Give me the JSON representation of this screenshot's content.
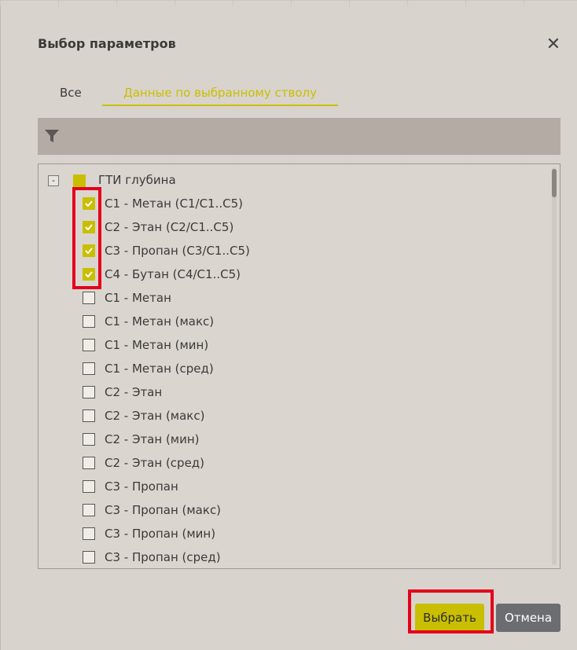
{
  "dialog": {
    "title": "Выбор параметров",
    "close_icon": "close-icon"
  },
  "tabs": [
    {
      "label": "Все",
      "active": false
    },
    {
      "label": "Данные по выбранному стволу",
      "active": true
    }
  ],
  "filter": {
    "icon": "filter-icon"
  },
  "tree": {
    "root": {
      "label": "ГТИ глубина",
      "expander": "-"
    },
    "items": [
      {
        "label": "C1 - Метан (C1/C1..C5)",
        "checked": true
      },
      {
        "label": "C2 - Этан (C2/C1..C5)",
        "checked": true
      },
      {
        "label": "C3 - Пропан (C3/C1..C5)",
        "checked": true
      },
      {
        "label": "C4 - Бутан (C4/C1..C5)",
        "checked": true
      },
      {
        "label": "C1 - Метан",
        "checked": false
      },
      {
        "label": "C1 - Метан (макс)",
        "checked": false
      },
      {
        "label": "C1 - Метан (мин)",
        "checked": false
      },
      {
        "label": "C1 - Метан (сред)",
        "checked": false
      },
      {
        "label": "C2 - Этан",
        "checked": false
      },
      {
        "label": "C2 - Этан (макс)",
        "checked": false
      },
      {
        "label": "C2 - Этан (мин)",
        "checked": false
      },
      {
        "label": "C2 - Этан (сред)",
        "checked": false
      },
      {
        "label": "C3 - Пропан",
        "checked": false
      },
      {
        "label": "C3 - Пропан (макс)",
        "checked": false
      },
      {
        "label": "C3 - Пропан (мин)",
        "checked": false
      },
      {
        "label": "C3 - Пропан (сред)",
        "checked": false
      }
    ]
  },
  "buttons": {
    "select": "Выбрать",
    "cancel": "Отмена"
  },
  "colors": {
    "accent": "#c9bf00",
    "highlight": "#e3001b",
    "cancel_bg": "#6b6d70"
  }
}
